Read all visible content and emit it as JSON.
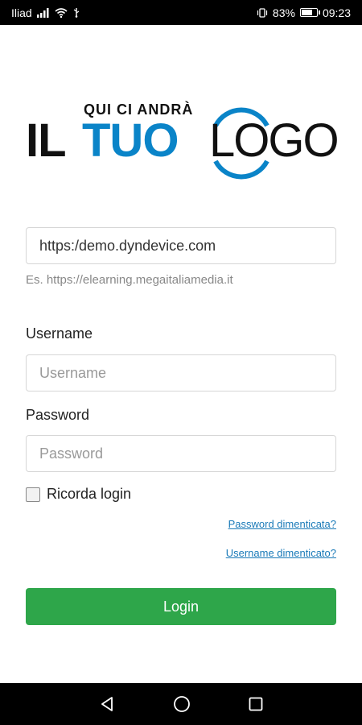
{
  "status_bar": {
    "carrier": "Iliad",
    "battery_percent": "83%",
    "battery_level": 0.83,
    "time": "09:23",
    "icons": [
      "signal-icon",
      "wifi-icon",
      "usb-icon",
      "vibrate-icon",
      "battery-icon"
    ]
  },
  "logo": {
    "small_text": "QUI CI ANDRÀ",
    "word1": "IL",
    "word2": "TUO",
    "word3": "LOGO",
    "accent_color": "#0a84c8"
  },
  "form": {
    "server_value": "https:/demo.dyndevice.com",
    "server_hint": "Es. https://elearning.megaitaliamedia.it",
    "username_label": "Username",
    "username_placeholder": "Username",
    "password_label": "Password",
    "password_placeholder": "Password",
    "remember_label": "Ricorda login",
    "remember_checked": false,
    "forgot_password": "Password dimenticata?",
    "forgot_username": "Username dimenticato?",
    "login_button": "Login",
    "login_color": "#2ea64a"
  },
  "nav_bar": {
    "icons": [
      "back-icon",
      "home-icon",
      "recents-icon"
    ]
  }
}
